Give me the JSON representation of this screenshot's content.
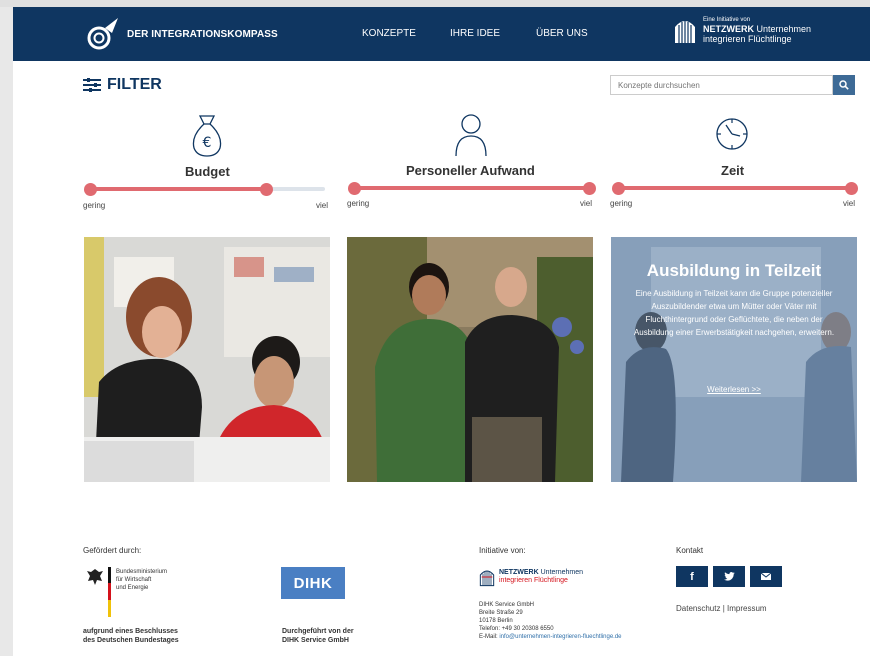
{
  "header": {
    "logo_text": "DER INTEGRATIONSKOMPASS",
    "nav": [
      "KONZEPTE",
      "IHRE IDEE",
      "ÜBER UNS"
    ],
    "partner_small": "Eine Initiative von",
    "partner_line2_bold": "NETZWERK",
    "partner_line2_rest": " Unternehmen",
    "partner_line3": "integrieren Flüchtlinge"
  },
  "filter": {
    "title": "FILTER",
    "search_placeholder": "Konzepte durchsuchen",
    "items": [
      {
        "label": "Budget",
        "icon": "money-bag-icon",
        "min": "gering",
        "max": "viel",
        "range": [
          0,
          0.75
        ]
      },
      {
        "label": "Personeller Aufwand",
        "icon": "person-icon",
        "min": "gering",
        "max": "viel",
        "range": [
          0,
          1
        ]
      },
      {
        "label": "Zeit",
        "icon": "clock-icon",
        "min": "gering",
        "max": "viel",
        "range": [
          0,
          1
        ]
      }
    ]
  },
  "cards": [
    {
      "image": "photo-office-woman-man-computer"
    },
    {
      "image": "photo-two-gardeners"
    },
    {
      "image": "photo-meeting-whiteboard",
      "title": "Ausbildung in Teilzeit",
      "text": "Eine Ausbildung in Teilzeit kann die Gruppe potenzieller Auszubildender etwa um Mütter oder Väter mit Fluchthintergrund oder Geflüchtete, die neben der Ausbildung einer Erwerbstätigkeit nachgehen, erweitern.",
      "link": "Weiterlesen >>"
    }
  ],
  "footer": {
    "funded_label": "Gefördert durch:",
    "ministry_line1": "Bundesministerium",
    "ministry_line2": "für Wirtschaft",
    "ministry_line3": "und Energie",
    "ministry_note1": "aufgrund eines Beschlusses",
    "ministry_note2": "des Deutschen Bundestages",
    "dihk_logo": "DIHK",
    "dihk_note1": "Durchgeführt von der",
    "dihk_note2": "DIHK Service GmbH",
    "initiative_label": "Initiative von:",
    "netzwerk_line1_bold": "NETZWERK",
    "netzwerk_line1_rest": " Unternehmen",
    "netzwerk_line2": "integrieren Flüchtlinge",
    "address": [
      "DIHK Service GmbH",
      "Breite Straße 29",
      "10178 Berlin",
      "Telefon: +49 30 20308 6550"
    ],
    "email_label": "E-Mail: ",
    "email": "info@unternehmen-integrieren-fluechtlinge.de",
    "contact_label": "Kontakt",
    "social": [
      "f",
      "twitter-icon",
      "mail-icon"
    ],
    "legal": "Datenschutz | Impressum"
  },
  "colors": {
    "navy": "#0f3661",
    "accent": "#e06a70",
    "link": "#2f6fa8"
  }
}
